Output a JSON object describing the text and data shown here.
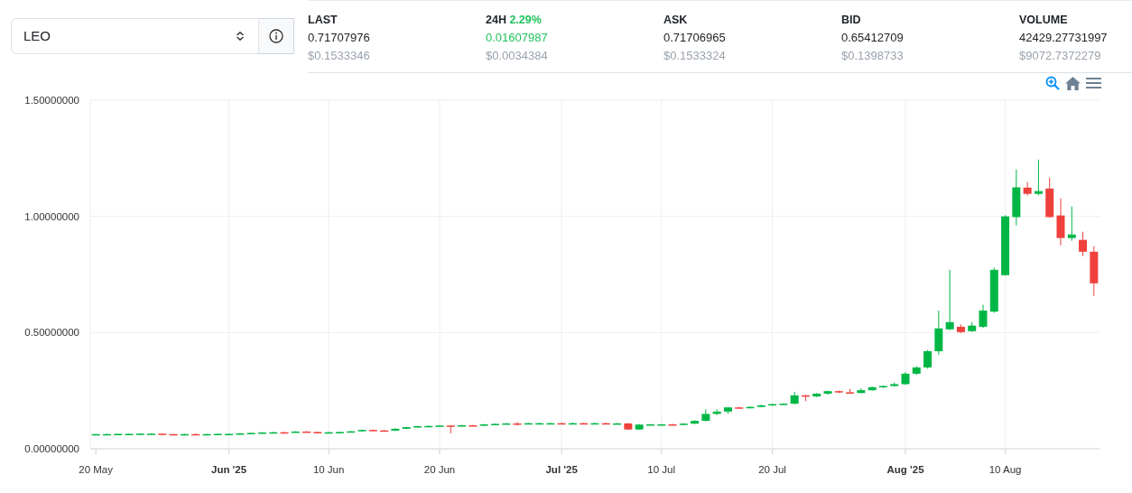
{
  "pair_select": {
    "value": "LEO"
  },
  "stats": [
    {
      "label": "LAST",
      "value": "0.71707976",
      "usd": "$0.1533346"
    },
    {
      "label": "24H",
      "change": "2.29%",
      "color": "#21c45d",
      "value": "0.01607987",
      "usd": "$0.0034384"
    },
    {
      "label": "ASK",
      "value": "0.71706965",
      "usd": "$0.1533324"
    },
    {
      "label": "BID",
      "value": "0.65412709",
      "usd": "$0.1398733"
    },
    {
      "label": "VOLUME",
      "value": "42429.27731997",
      "usd": "$9072.7372279"
    }
  ],
  "chart": {
    "y_axis_labels": [
      "1.50000000",
      "1.00000000",
      "0.50000000",
      "0.00000000"
    ],
    "x_axis_labels": [
      {
        "label": "20 May",
        "month_start": false
      },
      {
        "label": "Jun '25",
        "month_start": true
      },
      {
        "label": "10 Jun",
        "month_start": false
      },
      {
        "label": "20 Jun",
        "month_start": false
      },
      {
        "label": "Jul '25",
        "month_start": true
      },
      {
        "label": "10 Jul",
        "month_start": false
      },
      {
        "label": "20 Jul",
        "month_start": false
      },
      {
        "label": "Aug '25",
        "month_start": true
      },
      {
        "label": "10 Aug",
        "month_start": false
      }
    ]
  }
}
